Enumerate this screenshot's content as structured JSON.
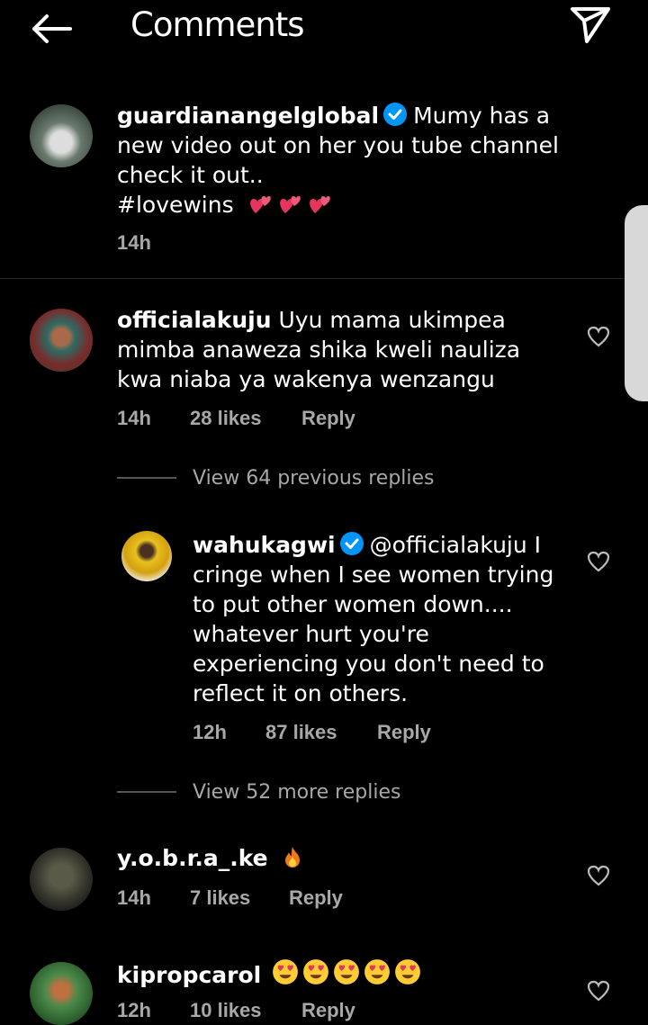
{
  "header": {
    "title": "Comments"
  },
  "comments": [
    {
      "username": "guardianangelglobal",
      "text": "Mumy has a new video out on her you tube channel check it out..",
      "hashtag": "#lovewins",
      "time": "14h"
    },
    {
      "username": "officialakuju",
      "text": "Uyu mama ukimpea mimba anaweza shika kweli nauliza kwa niaba ya wakenya wenzangu",
      "time": "14h",
      "likes": "28 likes",
      "reply": "Reply",
      "view_replies": "View 64 previous replies",
      "replies": [
        {
          "username": "wahukagwi",
          "mention": "@officialakuju",
          "text": "I cringe when I see women trying to put other women down.... whatever hurt you're experiencing you don't need to reflect it on others.",
          "time": "12h",
          "likes": "87 likes",
          "reply": "Reply"
        }
      ],
      "view_more": "View 52 more replies"
    },
    {
      "username": "y.o.b.r.a_.ke",
      "time": "14h",
      "likes": "7 likes",
      "reply": "Reply"
    },
    {
      "username": "kipropcarol",
      "time": "12h",
      "likes": "10 likes",
      "reply": "Reply"
    }
  ],
  "icons": [
    "back-arrow-icon",
    "send-icon",
    "verified-badge-icon",
    "heart-icon",
    "two-hearts-emoji",
    "fire-emoji",
    "heart-eyes-emoji"
  ],
  "colors": {
    "background": "#000000",
    "verified": "#0095f6",
    "meta": "#a8a8a8"
  }
}
